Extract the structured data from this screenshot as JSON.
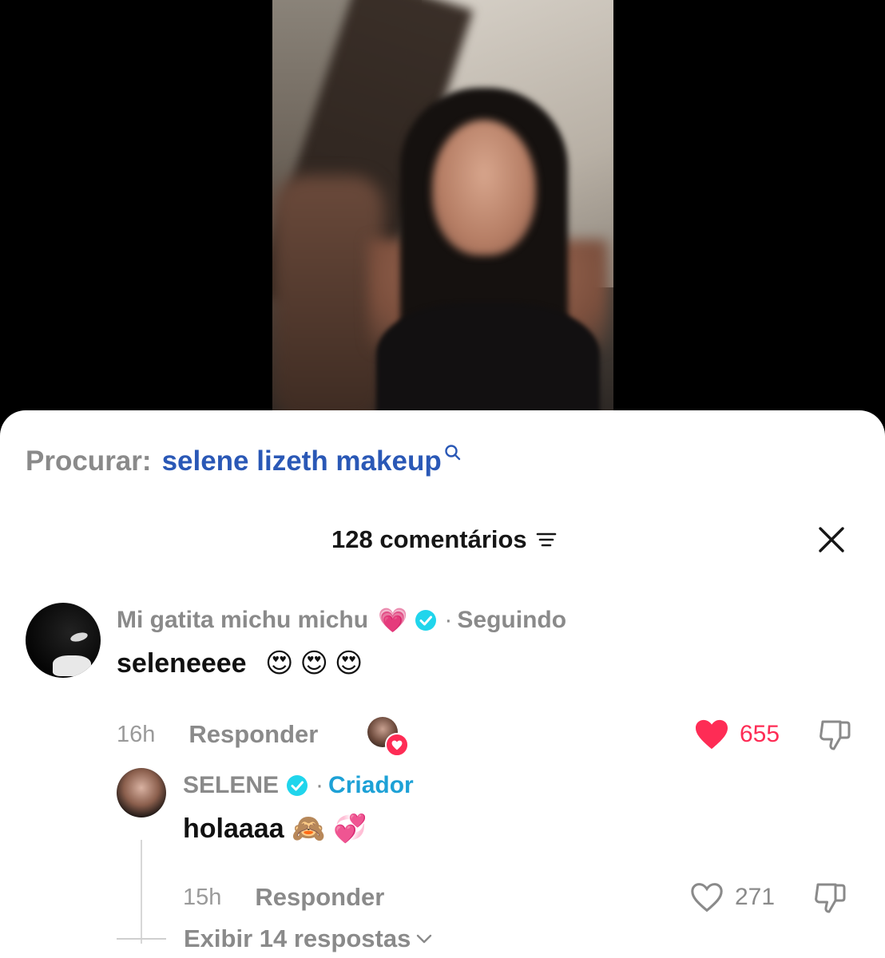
{
  "search": {
    "prefix": "Procurar:",
    "query": "selene lizeth makeup"
  },
  "header": {
    "count_label": "128 comentários"
  },
  "comments": [
    {
      "username": "Mi gatita michu michu",
      "username_emoji": "💗",
      "separator": "·",
      "status": "Seguindo",
      "text": "seleneeee",
      "text_emoji": "😍😍😍",
      "time": "16h",
      "reply_label": "Responder",
      "likes": "655",
      "liked": true
    }
  ],
  "reply": {
    "username": "SELENE",
    "separator": "·",
    "badge": "Criador",
    "text": "holaaaa",
    "text_emoji": "🙈💞",
    "time": "15h",
    "reply_label": "Responder",
    "likes": "271",
    "liked": false
  },
  "view_replies_label": "Exibir 14 respostas",
  "colors": {
    "like_red": "#fe2c55",
    "search_blue": "#2a58b6",
    "verified_blue": "#20d5ec",
    "creator_blue": "#1da1d6"
  }
}
